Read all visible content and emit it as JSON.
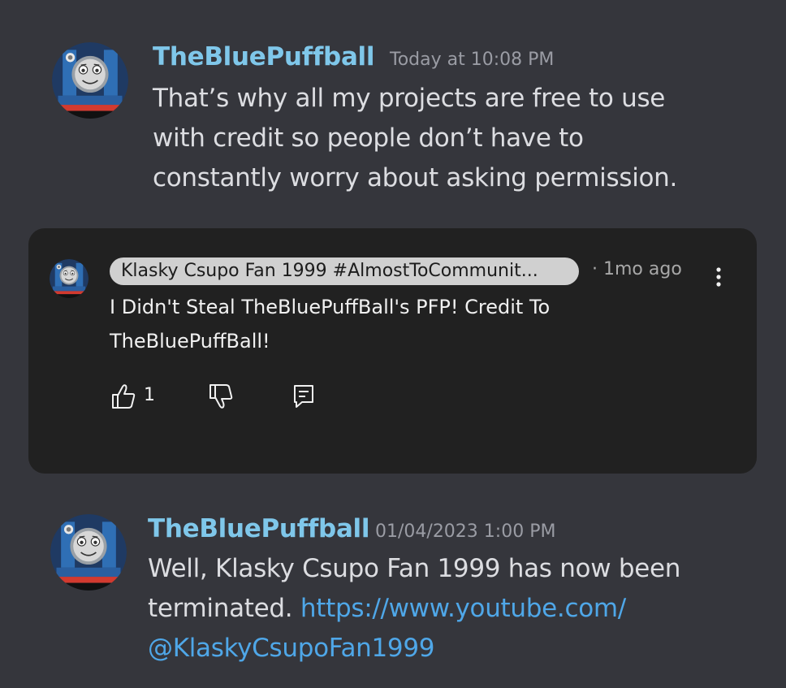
{
  "messages": [
    {
      "username": "TheBluePuffball",
      "timestamp": "Today at 10:08 PM",
      "lines": [
        "That’s why all my projects are free to use",
        "with credit so people don’t have to",
        "constantly worry about asking permission."
      ],
      "avatar": "thomas-tank-engine-avatar"
    },
    {
      "username": "TheBluePuffball",
      "timestamp": "01/04/2023 1:00 PM",
      "line1": "Well, Klasky Csupo Fan 1999 has now been",
      "line2_text": "terminated. ",
      "line2_link": "https://www.youtube.com/",
      "line3_link": "@KlaskyCsupoFan1999",
      "avatar": "thomas-tank-engine-avatar"
    }
  ],
  "comment_card": {
    "author": "Klasky Csupo Fan 1999 #AlmostToCommunit...",
    "age": "· 1mo ago",
    "text_lines": [
      "I Didn't Steal TheBluePuffBall's PFP! Credit To",
      "TheBluePuffBall!"
    ],
    "like_count": "1",
    "icons": [
      "thumbs-up-icon",
      "thumbs-down-icon",
      "reply-icon",
      "more-vert-icon"
    ]
  },
  "colors": {
    "background": "#35363c",
    "card_background": "#212121",
    "username": "#7fc7ea",
    "link": "#4fa7e8",
    "body_text": "#dcdde1",
    "timestamp": "#9a9ca4"
  }
}
